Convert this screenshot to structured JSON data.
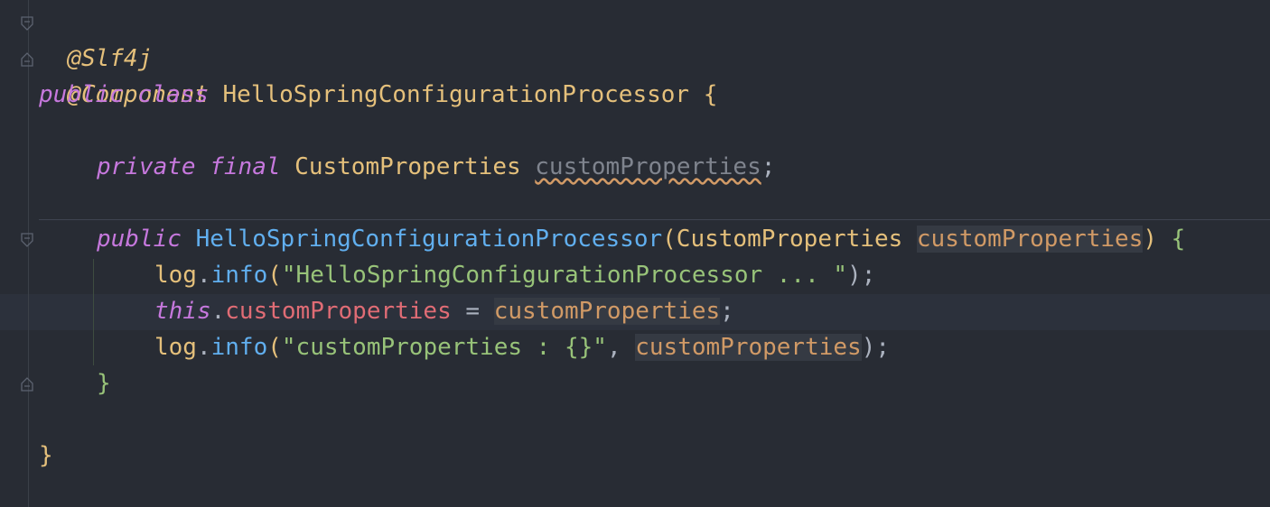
{
  "code": {
    "line1": {
      "annotation": "@Slf4j"
    },
    "line2": {
      "annotation": "@Component"
    },
    "line3": {
      "kw1": "public",
      "kw2": "class",
      "class_name": "HelloSpringConfigurationProcessor",
      "brace": "{"
    },
    "line5": {
      "kw1": "private",
      "kw2": "final",
      "type": "CustomProperties",
      "field": "customProperties",
      "semi": ";"
    },
    "line7": {
      "kw1": "public",
      "ctor": "HelloSpringConfigurationProcessor",
      "open": "(",
      "type": "CustomProperties",
      "param": "customProperties",
      "close": ")",
      "brace": "{"
    },
    "line8": {
      "obj": "log",
      "dot": ".",
      "method": "info",
      "open": "(",
      "str": "\"HelloSpringConfigurationProcessor ... \"",
      "close": ");"
    },
    "line9": {
      "kw": "this",
      "dot": ".",
      "field": "customProperties",
      "eq": " = ",
      "param": "customProperties",
      "semi": ";"
    },
    "line10": {
      "obj": "log",
      "dot": ".",
      "method": "info",
      "open": "(",
      "str": "\"customProperties : {}\"",
      "comma": ", ",
      "param": "customProperties",
      "close": ");"
    },
    "line11": {
      "brace": "}"
    },
    "line13": {
      "brace": "}"
    }
  }
}
